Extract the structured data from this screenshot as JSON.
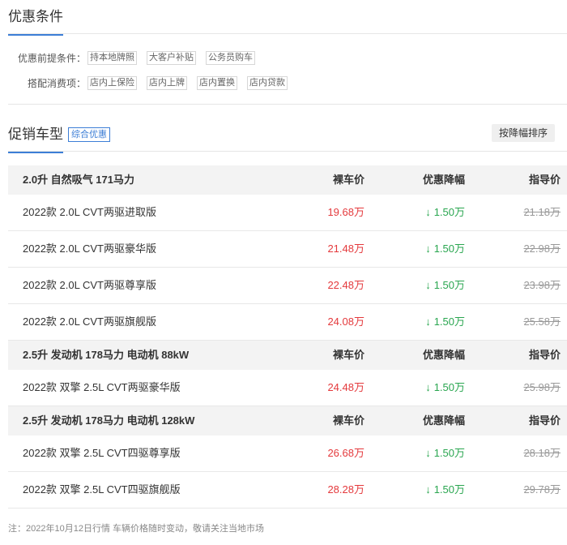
{
  "conditions": {
    "title": "优惠条件",
    "rows": [
      {
        "label": "优惠前提条件：",
        "tags": [
          "持本地牌照",
          "大客户补贴",
          "公务员购车"
        ]
      },
      {
        "label": "搭配消费项：",
        "tags": [
          "店内上保险",
          "店内上牌",
          "店内置换",
          "店内贷款"
        ]
      }
    ]
  },
  "promo": {
    "title": "促销车型",
    "badge": "综合优惠",
    "sort_button": "按降幅排序"
  },
  "table": {
    "groups": [
      {
        "name": "2.0升 自然吸气 171马力",
        "headers": {
          "price": "裸车价",
          "discount": "优惠降幅",
          "guide": "指导价"
        },
        "rows": [
          {
            "name": "2022款 2.0L CVT两驱进取版",
            "price": "19.68万",
            "discount": "1.50万",
            "guide": "21.18万"
          },
          {
            "name": "2022款 2.0L CVT两驱豪华版",
            "price": "21.48万",
            "discount": "1.50万",
            "guide": "22.98万"
          },
          {
            "name": "2022款 2.0L CVT两驱尊享版",
            "price": "22.48万",
            "discount": "1.50万",
            "guide": "23.98万"
          },
          {
            "name": "2022款 2.0L CVT两驱旗舰版",
            "price": "24.08万",
            "discount": "1.50万",
            "guide": "25.58万"
          }
        ]
      },
      {
        "name": "2.5升 发动机 178马力 电动机 88kW",
        "headers": {
          "price": "裸车价",
          "discount": "优惠降幅",
          "guide": "指导价"
        },
        "rows": [
          {
            "name": "2022款 双擎 2.5L CVT两驱豪华版",
            "price": "24.48万",
            "discount": "1.50万",
            "guide": "25.98万"
          }
        ]
      },
      {
        "name": "2.5升 发动机 178马力 电动机 128kW",
        "headers": {
          "price": "裸车价",
          "discount": "优惠降幅",
          "guide": "指导价"
        },
        "rows": [
          {
            "name": "2022款 双擎 2.5L CVT四驱尊享版",
            "price": "26.68万",
            "discount": "1.50万",
            "guide": "28.18万"
          },
          {
            "name": "2022款 双擎 2.5L CVT四驱旗舰版",
            "price": "28.28万",
            "discount": "1.50万",
            "guide": "29.78万"
          }
        ]
      }
    ]
  },
  "footnote": "注：2022年10月12日行情 车辆价格随时变动，敬请关注当地市场",
  "colors": {
    "accent": "#3c7ed6",
    "price": "#e4393c",
    "discount": "#2aa650",
    "guide": "#999999"
  },
  "icons": {
    "discount_arrow": "down-arrow-icon"
  }
}
